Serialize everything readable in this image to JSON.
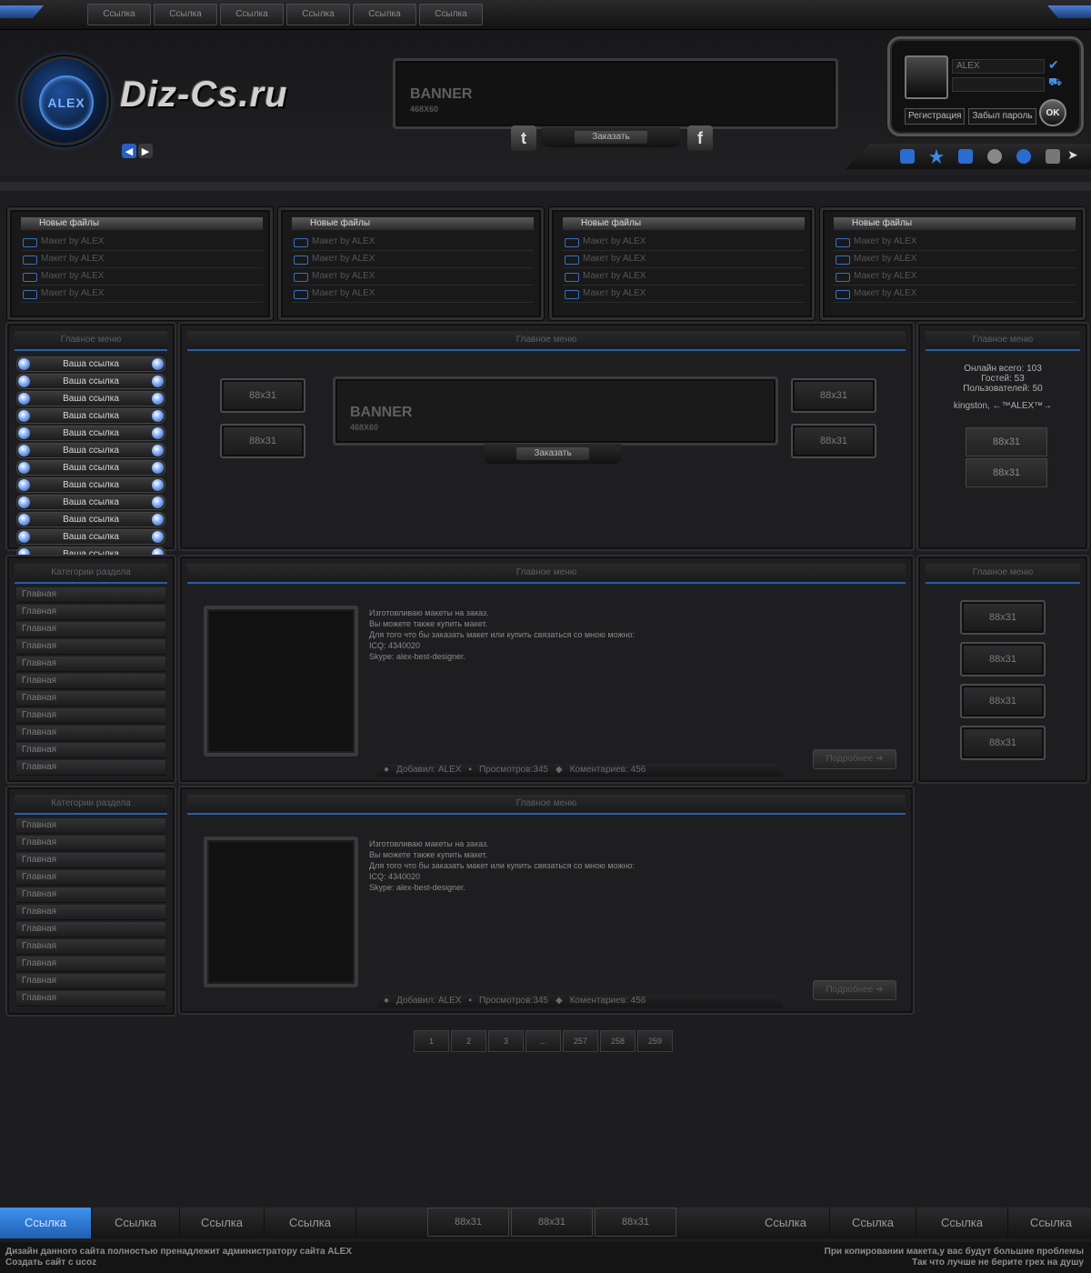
{
  "top_nav": [
    "Ссылка",
    "Ссылка",
    "Ссылка",
    "Ссылка",
    "Ссылка",
    "Ссылка"
  ],
  "logo": {
    "badge": "ALEX",
    "site_name": "Diz-Cs.ru"
  },
  "top_banner": {
    "title": "BANNER",
    "size": "468X60",
    "order_label": "Заказать"
  },
  "login": {
    "username": "ALEX",
    "register_label": "Регистрация",
    "forgot_label": "Забыл пароль",
    "ok_label": "OK"
  },
  "new_files": [
    {
      "header": "Новые файлы",
      "items": [
        "Макет by ALEX",
        "Макет by ALEX",
        "Макет by ALEX",
        "Макет by ALEX"
      ]
    },
    {
      "header": "Новые файлы",
      "items": [
        "Макет by ALEX",
        "Макет by ALEX",
        "Макет by ALEX",
        "Макет by ALEX"
      ]
    },
    {
      "header": "Новые файлы",
      "items": [
        "Макет by ALEX",
        "Макет by ALEX",
        "Макет by ALEX",
        "Макет by ALEX"
      ]
    },
    {
      "header": "Новые файлы",
      "items": [
        "Макет by ALEX",
        "Макет by ALEX",
        "Макет by ALEX",
        "Макет by ALEX"
      ]
    }
  ],
  "left_menu": {
    "title": "Главное меню",
    "items": [
      "Ваша ссылка",
      "Ваша ссылка",
      "Ваша ссылка",
      "Ваша ссылка",
      "Ваша ссылка",
      "Ваша ссылка",
      "Ваша ссылка",
      "Ваша ссылка",
      "Ваша ссылка",
      "Ваша ссылка",
      "Ваша ссылка",
      "Ваша ссылка"
    ]
  },
  "center_top": {
    "title": "Главное меню",
    "btn88": [
      "88x31",
      "88x31",
      "88x31",
      "88x31"
    ],
    "banner_title": "BANNER",
    "banner_size": "468X60",
    "order_label": "Заказать"
  },
  "stats": {
    "title": "Главное меню",
    "online": "Онлайн всего: 103",
    "guests": "Гостей: 53",
    "users": "Пользователей: 50",
    "who": "kingston, ←™ALEX™→",
    "btns": [
      "88x31",
      "88x31"
    ]
  },
  "categories": [
    {
      "title": "Категории раздела",
      "items": [
        "Главная",
        "Главная",
        "Главная",
        "Главная",
        "Главная",
        "Главная",
        "Главная",
        "Главная",
        "Главная",
        "Главная",
        "Главная"
      ]
    },
    {
      "title": "Категории раздела",
      "items": [
        "Главная",
        "Главная",
        "Главная",
        "Главная",
        "Главная",
        "Главная",
        "Главная",
        "Главная",
        "Главная",
        "Главная",
        "Главная"
      ]
    }
  ],
  "posts": [
    {
      "title": "Главное меню",
      "lines": [
        "Изготовливаю макеты на заказ.",
        "Вы можете также купить макет.",
        "Для того что бы заказать макет или купить связаться со мною можно:",
        "ICQ: 4340020",
        "Skype: alex-best-designer."
      ],
      "author": "Добавил: ALEX",
      "views": "Просмотров:345",
      "comments": "Коментариев: 456",
      "more": "Подробнее"
    },
    {
      "title": "Главное меню",
      "lines": [
        "Изготовливаю макеты на заказ.",
        "Вы можете также купить макет.",
        "Для того что бы заказать макет или купить связаться со мною можно:",
        "ICQ: 4340020",
        "Skype: alex-best-designer."
      ],
      "author": "Добавил: ALEX",
      "views": "Просмотров:345",
      "comments": "Коментариев: 456",
      "more": "Подробнее"
    }
  ],
  "right_btns": {
    "title": "Главное меню",
    "items": [
      "88x31",
      "88x31",
      "88x31",
      "88x31"
    ]
  },
  "pagination": [
    "1",
    "2",
    "3",
    "...",
    "257",
    "258",
    "259"
  ],
  "footer": {
    "left_links": [
      "Ссылка",
      "Ссылка",
      "Ссылка",
      "Ссылка"
    ],
    "btns": [
      "88x31",
      "88x31",
      "88x31"
    ],
    "right_links": [
      "Ссылка",
      "Ссылка",
      "Ссылка",
      "Ссылка"
    ],
    "copy_left": [
      "Дизайн данного сайта полностью пренадлежит администратору сайта ALEX",
      "Создать сайт с ucoz"
    ],
    "copy_right": [
      "При копировании макета,у вас будут большие проблемы",
      "Так что лучше не берите грех на душу"
    ]
  },
  "colors": {
    "accent": "#2a6cd0",
    "bg": "#1d1d1f",
    "active_link": "#2f7fd8"
  }
}
